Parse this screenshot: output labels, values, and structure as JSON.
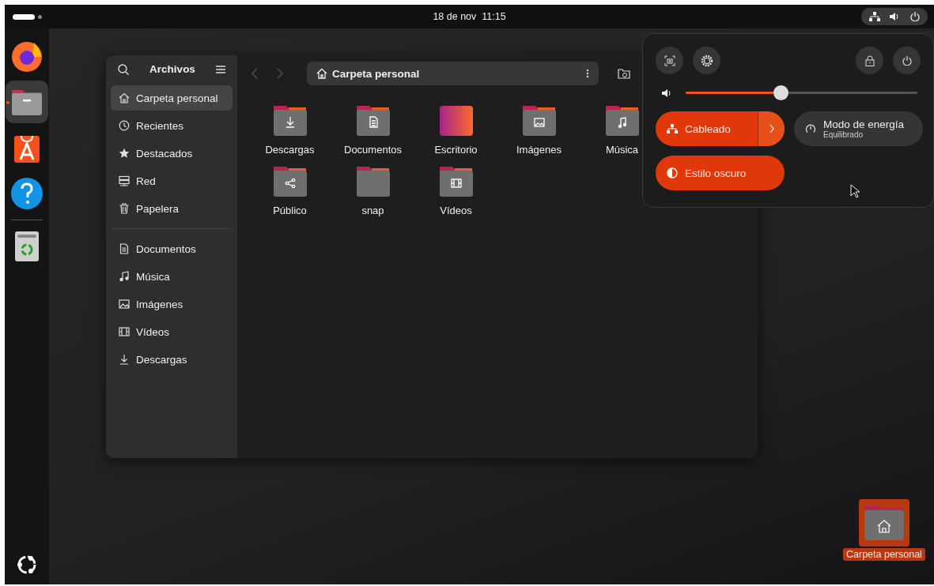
{
  "top_bar": {
    "clock": "18 de nov  11:15"
  },
  "dock": {
    "apps": [
      {
        "kind": "firefox",
        "running": false,
        "selected": false
      },
      {
        "kind": "files",
        "running": true,
        "selected": true
      },
      {
        "kind": "store",
        "running": false,
        "selected": false
      },
      {
        "kind": "help",
        "running": false,
        "selected": false
      },
      {
        "kind": "trash",
        "running": false,
        "selected": false
      }
    ]
  },
  "files_window": {
    "sidebar": {
      "title": "Archivos",
      "places": [
        {
          "kind": "home",
          "label": "Carpeta personal",
          "selected": true
        },
        {
          "kind": "recent",
          "label": "Recientes",
          "selected": false
        },
        {
          "kind": "star",
          "label": "Destacados",
          "selected": false
        },
        {
          "kind": "network",
          "label": "Red",
          "selected": false
        },
        {
          "kind": "trash",
          "label": "Papelera",
          "selected": false
        }
      ],
      "bookmarks": [
        {
          "kind": "document",
          "label": "Documentos",
          "selected": false
        },
        {
          "kind": "music",
          "label": "Música",
          "selected": false
        },
        {
          "kind": "image",
          "label": "Imágenes",
          "selected": false
        },
        {
          "kind": "video",
          "label": "Vídeos",
          "selected": false
        },
        {
          "kind": "download",
          "label": "Descargas",
          "selected": false
        }
      ]
    },
    "path_bar": {
      "location": "Carpeta personal"
    },
    "folders": [
      {
        "kind": "download",
        "name": "Descargas"
      },
      {
        "kind": "document",
        "name": "Documentos"
      },
      {
        "kind": "desktop",
        "name": "Escritorio"
      },
      {
        "kind": "image",
        "name": "Imágenes"
      },
      {
        "kind": "music",
        "name": "Música"
      },
      {
        "kind": "share",
        "name": "Público"
      },
      {
        "kind": "plain",
        "name": "snap"
      },
      {
        "kind": "video",
        "name": "Vídeos"
      }
    ]
  },
  "quick_settings": {
    "volume": {
      "level": 0.41
    },
    "toggles": [
      {
        "kind": "network",
        "label": "Cableado",
        "on": true,
        "has_menu": true
      },
      {
        "kind": "power",
        "label": "Modo de energía",
        "subtitle": "Equilibrado",
        "on": false,
        "has_menu": false
      },
      {
        "kind": "dark",
        "label": "Estilo oscuro",
        "on": true,
        "has_menu": false
      }
    ]
  },
  "desktop_icons": [
    {
      "label": "Carpeta personal",
      "selected": true
    }
  ]
}
